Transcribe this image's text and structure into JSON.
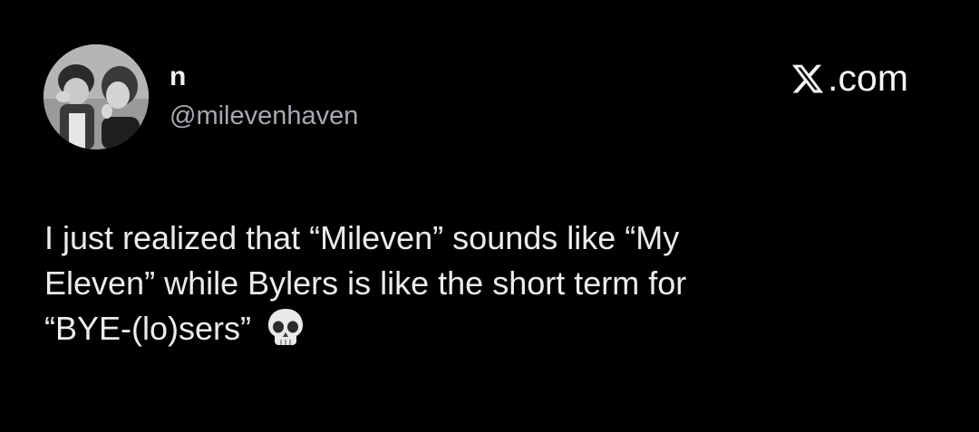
{
  "tweet": {
    "display_name": "n",
    "handle": "@milevenhaven",
    "brand": ".com",
    "brand_icon": "x-logo-icon",
    "text_lines": [
      "I just realized that “Mileven” sounds like “My",
      "Eleven” while Bylers is like the short term for",
      "“BYE-(lo)sers”"
    ],
    "emoji": "skull-icon"
  },
  "colors": {
    "background": "#000000",
    "text": "#ececec",
    "handle": "#a6aab0"
  }
}
